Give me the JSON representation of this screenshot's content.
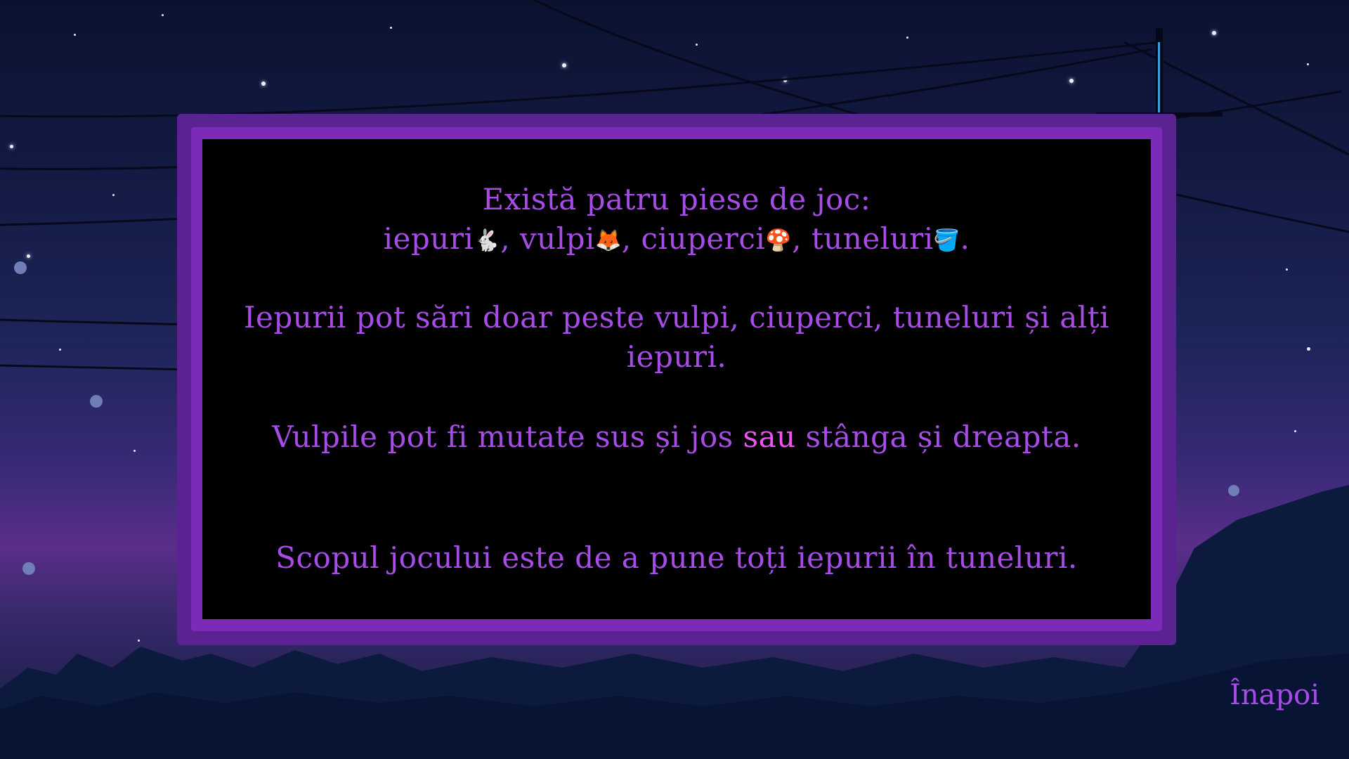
{
  "instructions": {
    "pieces_intro": "Există patru piese de joc:",
    "piece_rabbits": "iepuri",
    "piece_foxes": "vulpi",
    "piece_mushrooms": "ciuperci",
    "piece_tunnels": "tuneluri",
    "sep": ", ",
    "end": ".",
    "rabbit_rule": "Iepurii pot sări doar peste vulpi, ciuperci, tuneluri și alți iepuri.",
    "fox_rule_a": "Vulpile pot fi mutate sus și jos ",
    "fox_rule_hl": "sau",
    "fox_rule_b": " stânga și dreapta.",
    "goal": "Scopul jocului este de a pune toți iepurii în tuneluri."
  },
  "icons": {
    "rabbit": "rabbit-icon",
    "fox": "fox-icon",
    "mushroom": "mushroom-icon",
    "tunnel": "tunnel-icon"
  },
  "nav": {
    "back_label": "Înapoi"
  },
  "colors": {
    "text": "#a84ce8",
    "highlight": "#ec56f0",
    "frame_outer": "#5b2391",
    "frame_mid": "#7a2bb8"
  }
}
